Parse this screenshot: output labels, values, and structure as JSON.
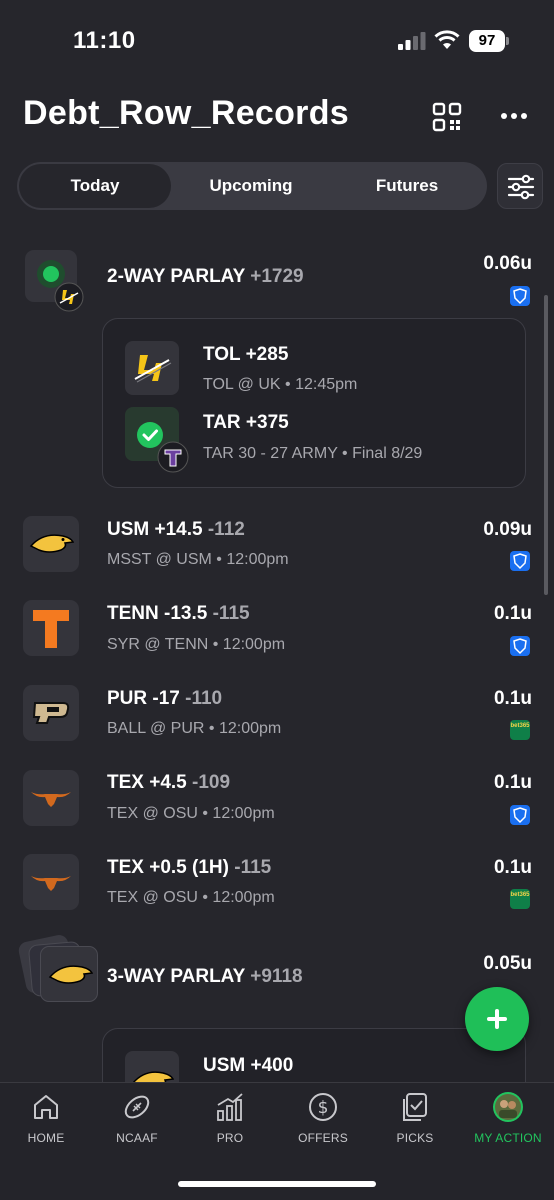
{
  "status": {
    "time": "11:10",
    "battery": "97"
  },
  "header": {
    "title": "Debt_Row_Records"
  },
  "tabs": [
    "Today",
    "Upcoming",
    "Futures"
  ],
  "colors": {
    "bg": "#26262c",
    "accent": "#22c45e",
    "fanduel": "#1a6ff0",
    "bet365": "#0f7f48"
  },
  "bets": [
    {
      "title": "2-WAY PARLAY",
      "odds": "+1729",
      "units": "0.06u",
      "book": "fanduel-icon",
      "legs": [
        {
          "title": "TOL +285",
          "sub": "TOL @ UK • 12:45pm"
        },
        {
          "title": "TAR +375",
          "sub": "TAR 30 - 27 ARMY • Final 8/29"
        }
      ]
    },
    {
      "title": "USM +14.5",
      "odds": "-112",
      "sub": "MSST @ USM • 12:00pm",
      "units": "0.09u",
      "book": "fanduel-icon"
    },
    {
      "title": "TENN -13.5",
      "odds": "-115",
      "sub": "SYR @ TENN • 12:00pm",
      "units": "0.1u",
      "book": "fanduel-icon"
    },
    {
      "title": "PUR -17",
      "odds": "-110",
      "sub": "BALL @ PUR • 12:00pm",
      "units": "0.1u",
      "book": "bet365-icon",
      "bookText": "bet365"
    },
    {
      "title": "TEX +4.5",
      "odds": "-109",
      "sub": "TEX @ OSU • 12:00pm",
      "units": "0.1u",
      "book": "fanduel-icon"
    },
    {
      "title": "TEX +0.5 (1H)",
      "odds": "-115",
      "sub": "TEX @ OSU • 12:00pm",
      "units": "0.1u",
      "book": "bet365-icon",
      "bookText": "bet365"
    },
    {
      "title": "3-WAY PARLAY",
      "odds": "+9118",
      "units": "0.05u",
      "book": "bet365-icon",
      "legs": [
        {
          "title": "USM +400"
        }
      ]
    }
  ],
  "nav": [
    {
      "label": "HOME",
      "icon": "home-icon"
    },
    {
      "label": "NCAAF",
      "icon": "football-icon"
    },
    {
      "label": "PRO",
      "icon": "chart-icon"
    },
    {
      "label": "OFFERS",
      "icon": "dollar-icon"
    },
    {
      "label": "PICKS",
      "icon": "picks-icon"
    },
    {
      "label": "MY ACTION",
      "icon": "avatar-icon",
      "active": true
    }
  ]
}
